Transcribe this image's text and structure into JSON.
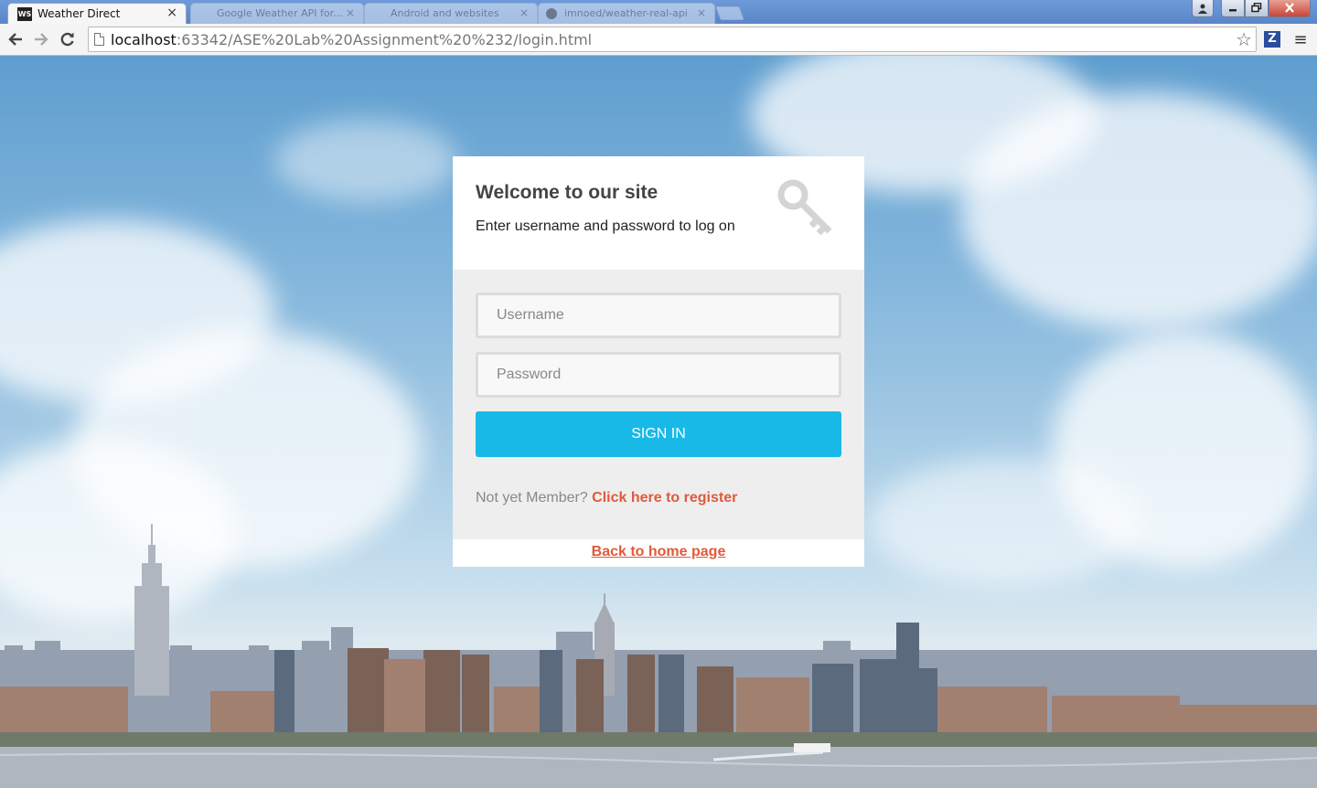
{
  "browser": {
    "active_tab": {
      "favicon": "WS",
      "title": "Weather Direct",
      "close": "×"
    },
    "inactive_tabs": [
      {
        "title": "Google Weather API for...",
        "close": "×"
      },
      {
        "title": "Android and websites",
        "close": "×"
      },
      {
        "title": "imnoed/weather-real-api",
        "close": "×"
      }
    ],
    "url_host": "localhost",
    "url_rest": ":63342/ASE%20Lab%20Assignment%20%232/login.html",
    "extension_label": "Z"
  },
  "login": {
    "title": "Welcome to our site",
    "subtitle": "Enter username and password to log on",
    "username_placeholder": "Username",
    "password_placeholder": "Password",
    "signin_label": "SIGN IN",
    "member_prompt": "Not yet Member?",
    "register_link": "Click here to register",
    "back_link": "Back to home page"
  },
  "colors": {
    "accent": "#19b9e7",
    "link": "#e05a3a",
    "panel_body": "#eeeeee"
  },
  "icons": [
    "key-icon",
    "back-arrow-icon",
    "forward-arrow-icon",
    "reload-icon",
    "star-icon",
    "menu-icon",
    "page-icon",
    "user-icon",
    "minimize-icon",
    "maximize-icon",
    "close-icon"
  ]
}
